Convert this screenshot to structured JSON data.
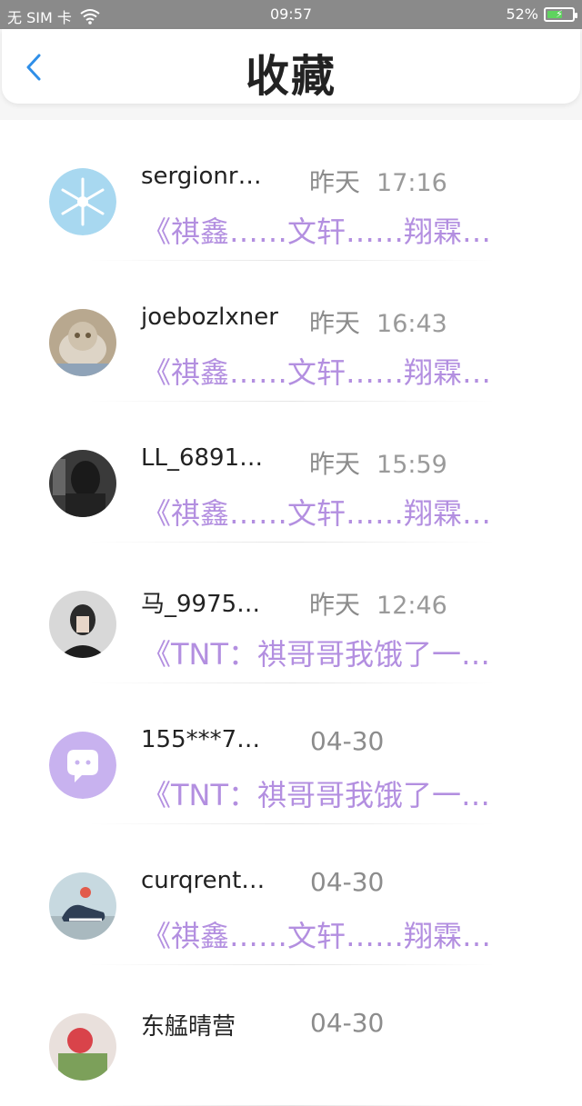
{
  "status": {
    "carrier": "无 SIM 卡",
    "time": "09:57",
    "battery": "52%",
    "battery_level": 0.52
  },
  "header": {
    "title": "收藏",
    "back_icon": "chevron-left-icon"
  },
  "items": [
    {
      "name": "sergionr…",
      "date": "昨天",
      "time": "17:16",
      "preview": "《祺鑫……文轩……翔霖…",
      "avatar": "snowflake"
    },
    {
      "name": "joebozlxner",
      "date": "昨天",
      "time": "16:43",
      "preview": "《祺鑫……文轩……翔霖…",
      "avatar": "cat-photo"
    },
    {
      "name": "LL_6891…",
      "date": "昨天",
      "time": "15:59",
      "preview": "《祺鑫……文轩……翔霖…",
      "avatar": "dark-photo"
    },
    {
      "name": "马_9975…",
      "date": "昨天",
      "time": "12:46",
      "preview": "《TNT：祺哥哥我饿了一…",
      "avatar": "person-photo"
    },
    {
      "name": "155***7…",
      "date": "04-30",
      "time": "",
      "preview": "《TNT：祺哥哥我饿了一…",
      "avatar": "chat-icon"
    },
    {
      "name": "curqrent…",
      "date": "04-30",
      "time": "",
      "preview": "《祺鑫……文轩……翔霖…",
      "avatar": "shoe-photo"
    },
    {
      "name": "东艋晴营",
      "date": "04-30",
      "time": "",
      "preview": "",
      "avatar": "flower-photo"
    }
  ]
}
